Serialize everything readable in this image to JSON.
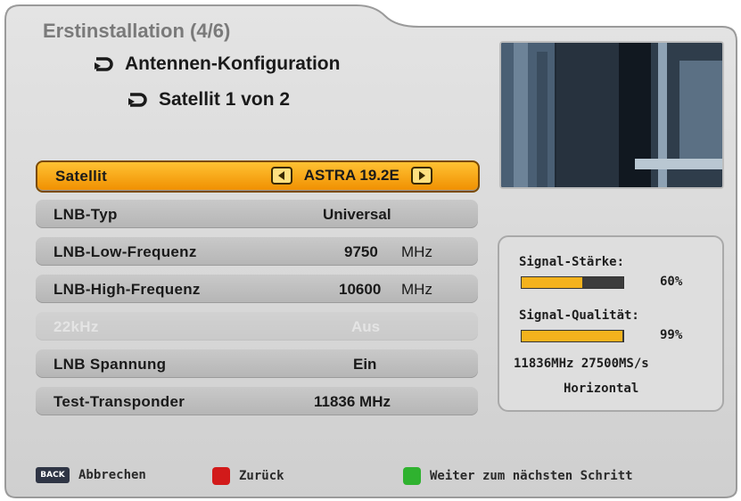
{
  "header": {
    "title": "Erstinstallation (4/6)",
    "section": "Antennen-Konfiguration",
    "subsection": "Satellit 1 von 2"
  },
  "settings": [
    {
      "label": "Satellit",
      "value": "ASTRA 19.2E",
      "unit": "",
      "selected": true,
      "disabled": false
    },
    {
      "label": "LNB-Typ",
      "value": "Universal",
      "unit": "",
      "selected": false,
      "disabled": false
    },
    {
      "label": "LNB-Low-Frequenz",
      "value": "9750",
      "unit": "MHz",
      "selected": false,
      "disabled": false
    },
    {
      "label": "LNB-High-Frequenz",
      "value": "10600",
      "unit": "MHz",
      "selected": false,
      "disabled": false
    },
    {
      "label": "22kHz",
      "value": "Aus",
      "unit": "",
      "selected": false,
      "disabled": true
    },
    {
      "label": "LNB Spannung",
      "value": "Ein",
      "unit": "",
      "selected": false,
      "disabled": false
    },
    {
      "label": "Test-Transponder",
      "value": "11836 MHz",
      "unit": "",
      "selected": false,
      "disabled": false
    }
  ],
  "signal": {
    "strength_label": "Signal-Stärke:",
    "strength_value": "60%",
    "strength_fraction": 0.6,
    "quality_label": "Signal-Qualität:",
    "quality_value": "99%",
    "quality_fraction": 0.99,
    "transponder": "11836MHz 27500MS/s",
    "polarization": "Horizontal"
  },
  "footer": {
    "back_key": "BACK",
    "cancel_label": "Abbrechen",
    "back_label": "Zurück",
    "next_label": "Weiter zum nächsten Schritt"
  },
  "colors": {
    "highlight": "#f5a623",
    "panel": "#d8d8d8",
    "signal_bar": "#f4b21d",
    "red_key": "#d21a1a",
    "green_key": "#2fb22f"
  },
  "icons": {
    "section": "redo-arrow-icon",
    "nav_left": "left-arrow-icon",
    "nav_right": "right-arrow-icon"
  }
}
